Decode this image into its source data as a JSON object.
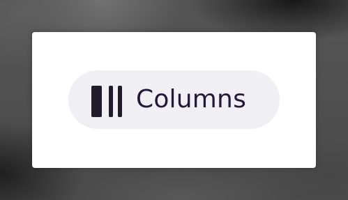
{
  "button": {
    "label": "Columns",
    "icon": "view-columns-icon"
  },
  "colors": {
    "text": "#22193a",
    "pill_background": "#f0eff3",
    "card_background": "#ffffff",
    "icon": "#201c2c"
  }
}
